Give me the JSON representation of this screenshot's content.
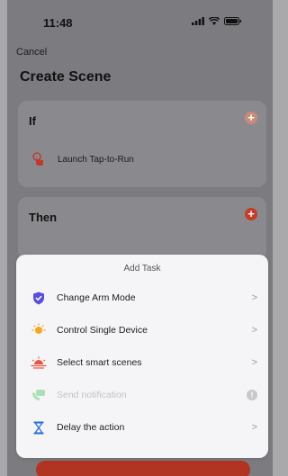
{
  "status_bar": {
    "time": "11:48"
  },
  "header": {
    "cancel_label": "Cancel",
    "title": "Create Scene"
  },
  "if_section": {
    "heading": "If",
    "add_icon": "plus-circle-icon",
    "condition_label": "Launch Tap-to-Run",
    "condition_icon": "tap-hand-icon"
  },
  "then_section": {
    "heading": "Then",
    "add_icon": "plus-circle-icon",
    "peek_label": "Add Task"
  },
  "sheet": {
    "title": "Add Task",
    "items": [
      {
        "label": "Change Arm Mode",
        "icon": "shield-icon",
        "enabled": true
      },
      {
        "label": "Control Single Device",
        "icon": "light-bulb-icon",
        "enabled": true
      },
      {
        "label": "Select smart scenes",
        "icon": "sunrise-icon",
        "enabled": true
      },
      {
        "label": "Send notification",
        "icon": "notification-icon",
        "enabled": false,
        "badge": "!"
      },
      {
        "label": "Delay the action",
        "icon": "hourglass-icon",
        "enabled": true
      }
    ]
  },
  "colors": {
    "accent_red": "#c43c2a",
    "shield_purple": "#5a4fd6",
    "bulb_orange": "#f5a623",
    "sunrise_red": "#e8563f",
    "hourglass_blue": "#2f6fd6",
    "disabled_green": "#a9e0b8"
  }
}
